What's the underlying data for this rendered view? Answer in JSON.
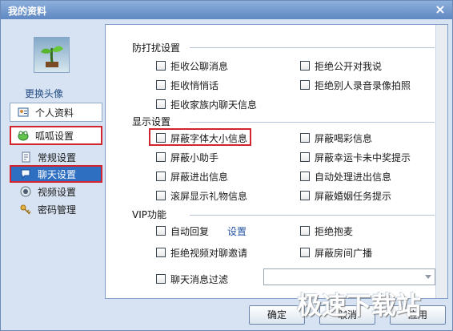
{
  "window": {
    "title": "我的资料",
    "close_label": "×"
  },
  "sidebar": {
    "avatar_icon": "plant-icon",
    "change_avatar": "更换头像",
    "items": [
      {
        "label": "个人资料",
        "icon": "profile-card-icon"
      },
      {
        "label": "呱呱设置",
        "icon": "frog-icon"
      },
      {
        "label": "常规设置",
        "icon": "document-settings-icon"
      },
      {
        "label": "聊天设置",
        "icon": "chat-icon"
      },
      {
        "label": "视频设置",
        "icon": "camera-icon"
      },
      {
        "label": "密码管理",
        "icon": "key-icon"
      }
    ]
  },
  "sections": {
    "anti_disturb": {
      "title": "防打扰设置",
      "options": [
        "拒收公聊消息",
        "拒绝公开对我说",
        "拒收悄悄话",
        "拒绝别人录音录像拍照",
        "拒收家族内聊天信息"
      ]
    },
    "display": {
      "title": "显示设置",
      "options": [
        "屏蔽字体大小信息",
        "屏蔽喝彩信息",
        "屏蔽小助手",
        "屏蔽幸运卡未中奖提示",
        "屏蔽进出信息",
        "自动处理进出信息",
        "滚屏显示礼物信息",
        "屏蔽婚姻任务提示"
      ]
    },
    "vip": {
      "title": "VIP功能",
      "options": [
        "自动回复",
        "拒绝抱麦",
        "拒绝视频对聊邀请",
        "屏蔽房间广播",
        "聊天消息过滤"
      ],
      "settings_link": "设置",
      "filter_value": ""
    }
  },
  "buttons": {
    "ok": "确定",
    "cancel": "取消",
    "apply": "应用"
  },
  "watermark": "极速下载站",
  "colors": {
    "title_bar": "#5f88c2",
    "accent_red": "#d3242d",
    "selected_blue": "#2f6fc2"
  }
}
